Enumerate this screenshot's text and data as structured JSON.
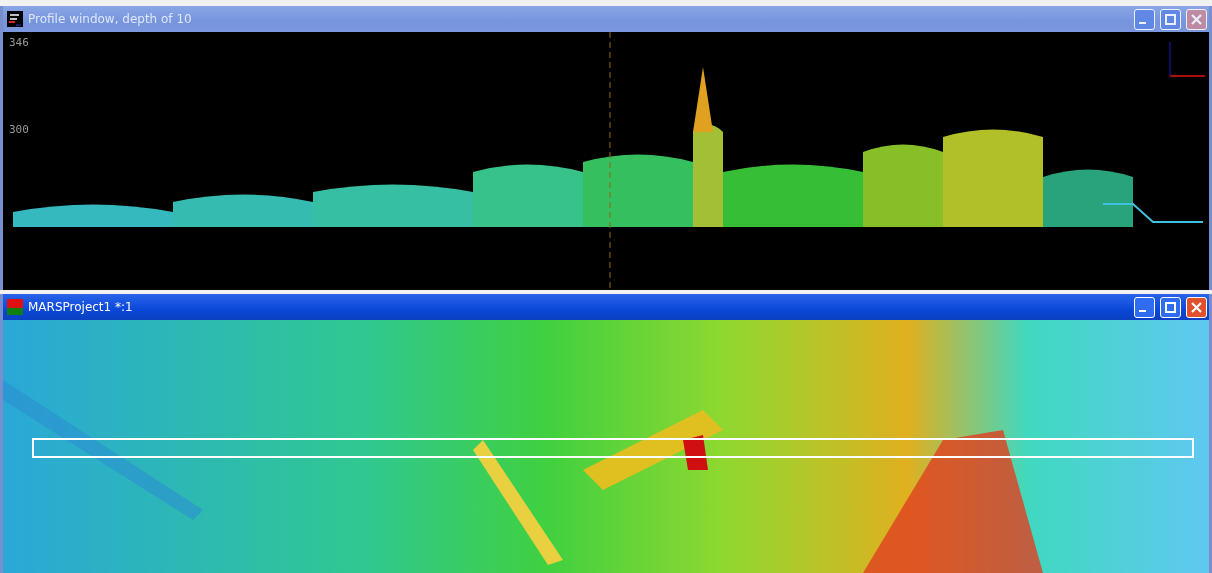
{
  "windows": [
    {
      "kind": "profile",
      "title": "Profile window, depth of 10",
      "active": false,
      "axis_labels": [
        "346",
        "300"
      ]
    },
    {
      "kind": "map",
      "title": "MARSProject1 *:1",
      "active": true
    }
  ]
}
